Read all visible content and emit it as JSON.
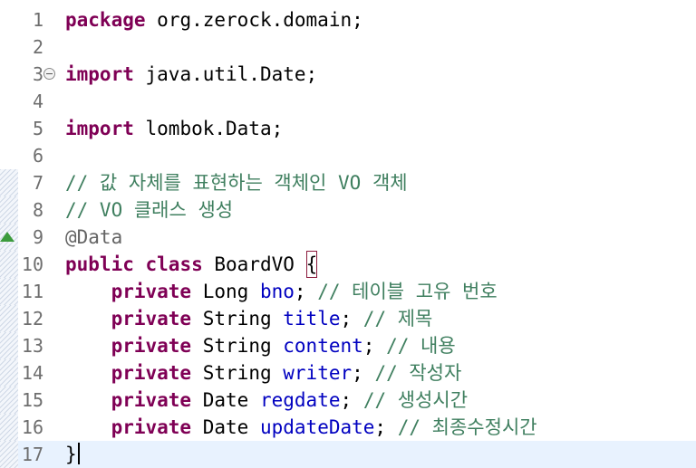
{
  "lines": [
    {
      "n": "1",
      "tokens": [
        [
          "kw",
          "package"
        ],
        [
          "",
          "org.zerock.domain;"
        ]
      ]
    },
    {
      "n": "2",
      "tokens": []
    },
    {
      "n": "3",
      "fold": true,
      "tokens": [
        [
          "kw",
          "import"
        ],
        [
          "",
          "java.util.Date;"
        ]
      ]
    },
    {
      "n": "4",
      "tokens": []
    },
    {
      "n": "5",
      "tokens": [
        [
          "kw",
          "import"
        ],
        [
          "",
          "lombok.Data;"
        ]
      ]
    },
    {
      "n": "6",
      "tokens": []
    },
    {
      "n": "7",
      "tokens": [
        [
          "cmt",
          "// 값 자체를 표현하는 객체인 VO 객체"
        ]
      ]
    },
    {
      "n": "8",
      "tokens": [
        [
          "cmt",
          "// VO 클래스 생성"
        ]
      ]
    },
    {
      "n": "9",
      "override": true,
      "tokens": [
        [
          "ann",
          "@Data"
        ]
      ]
    },
    {
      "n": "10",
      "tokens": [
        [
          "kw",
          "public"
        ],
        [
          "kw",
          "class"
        ],
        [
          "",
          "BoardVO"
        ],
        [
          "brace",
          "{"
        ]
      ]
    },
    {
      "n": "11",
      "tokens": [
        [
          "indent",
          "    "
        ],
        [
          "kw",
          "private"
        ],
        [
          "",
          "Long"
        ],
        [
          "fld",
          "bno"
        ],
        [
          "",
          ";"
        ],
        [
          "cmt",
          "// 테이블 고유 번호"
        ]
      ]
    },
    {
      "n": "12",
      "tokens": [
        [
          "indent",
          "    "
        ],
        [
          "kw",
          "private"
        ],
        [
          "",
          "String"
        ],
        [
          "fld",
          "title"
        ],
        [
          "",
          ";"
        ],
        [
          "cmt",
          "// 제목"
        ]
      ]
    },
    {
      "n": "13",
      "tokens": [
        [
          "indent",
          "    "
        ],
        [
          "kw",
          "private"
        ],
        [
          "",
          "String"
        ],
        [
          "fld",
          "content"
        ],
        [
          "",
          ";"
        ],
        [
          "cmt",
          "// 내용"
        ]
      ]
    },
    {
      "n": "14",
      "tokens": [
        [
          "indent",
          "    "
        ],
        [
          "kw",
          "private"
        ],
        [
          "",
          "String"
        ],
        [
          "fld",
          "writer"
        ],
        [
          "",
          ";"
        ],
        [
          "cmt",
          "// 작성자"
        ]
      ]
    },
    {
      "n": "15",
      "tokens": [
        [
          "indent",
          "    "
        ],
        [
          "kw",
          "private"
        ],
        [
          "",
          "Date"
        ],
        [
          "fld",
          "regdate"
        ],
        [
          "",
          ";"
        ],
        [
          "cmt",
          "// 생성시간"
        ]
      ]
    },
    {
      "n": "16",
      "tokens": [
        [
          "indent",
          "    "
        ],
        [
          "kw",
          "private"
        ],
        [
          "",
          "Date"
        ],
        [
          "fld",
          "updateDate"
        ],
        [
          "",
          ";"
        ],
        [
          "cmt",
          "// 최종수정시간"
        ]
      ]
    },
    {
      "n": "17",
      "current": true,
      "tokens": [
        [
          "",
          "}"
        ],
        [
          "caret",
          ""
        ]
      ]
    }
  ]
}
